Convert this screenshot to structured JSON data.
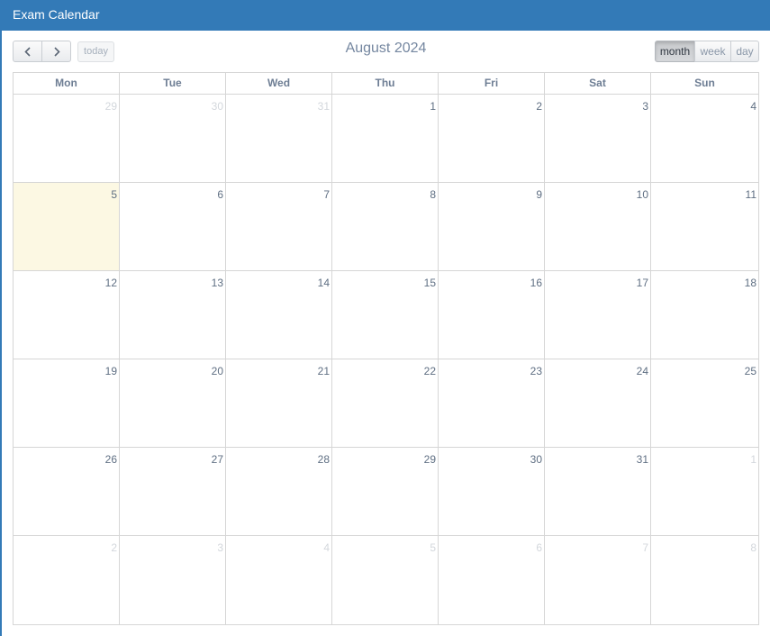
{
  "panel": {
    "title": "Exam Calendar"
  },
  "toolbar": {
    "prev_icon": "chevron-left-icon",
    "next_icon": "chevron-right-icon",
    "today_label": "today",
    "title": "August 2024",
    "views": {
      "month": "month",
      "week": "week",
      "day": "day"
    },
    "active_view": "month"
  },
  "calendar": {
    "weekdays": [
      "Mon",
      "Tue",
      "Wed",
      "Thu",
      "Fri",
      "Sat",
      "Sun"
    ],
    "today": "5",
    "weeks": [
      [
        {
          "d": "29",
          "o": true
        },
        {
          "d": "30",
          "o": true
        },
        {
          "d": "31",
          "o": true
        },
        {
          "d": "1",
          "o": false
        },
        {
          "d": "2",
          "o": false
        },
        {
          "d": "3",
          "o": false
        },
        {
          "d": "4",
          "o": false
        }
      ],
      [
        {
          "d": "5",
          "o": false,
          "t": true
        },
        {
          "d": "6",
          "o": false
        },
        {
          "d": "7",
          "o": false
        },
        {
          "d": "8",
          "o": false
        },
        {
          "d": "9",
          "o": false
        },
        {
          "d": "10",
          "o": false
        },
        {
          "d": "11",
          "o": false
        }
      ],
      [
        {
          "d": "12",
          "o": false
        },
        {
          "d": "13",
          "o": false
        },
        {
          "d": "14",
          "o": false
        },
        {
          "d": "15",
          "o": false
        },
        {
          "d": "16",
          "o": false
        },
        {
          "d": "17",
          "o": false
        },
        {
          "d": "18",
          "o": false
        }
      ],
      [
        {
          "d": "19",
          "o": false
        },
        {
          "d": "20",
          "o": false
        },
        {
          "d": "21",
          "o": false
        },
        {
          "d": "22",
          "o": false
        },
        {
          "d": "23",
          "o": false
        },
        {
          "d": "24",
          "o": false
        },
        {
          "d": "25",
          "o": false
        }
      ],
      [
        {
          "d": "26",
          "o": false
        },
        {
          "d": "27",
          "o": false
        },
        {
          "d": "28",
          "o": false
        },
        {
          "d": "29",
          "o": false
        },
        {
          "d": "30",
          "o": false
        },
        {
          "d": "31",
          "o": false
        },
        {
          "d": "1",
          "o": true
        }
      ],
      [
        {
          "d": "2",
          "o": true
        },
        {
          "d": "3",
          "o": true
        },
        {
          "d": "4",
          "o": true
        },
        {
          "d": "5",
          "o": true
        },
        {
          "d": "6",
          "o": true
        },
        {
          "d": "7",
          "o": true
        },
        {
          "d": "8",
          "o": true
        }
      ]
    ]
  },
  "colors": {
    "header_bg": "#337ab7",
    "today_bg": "#fcf8e3"
  }
}
